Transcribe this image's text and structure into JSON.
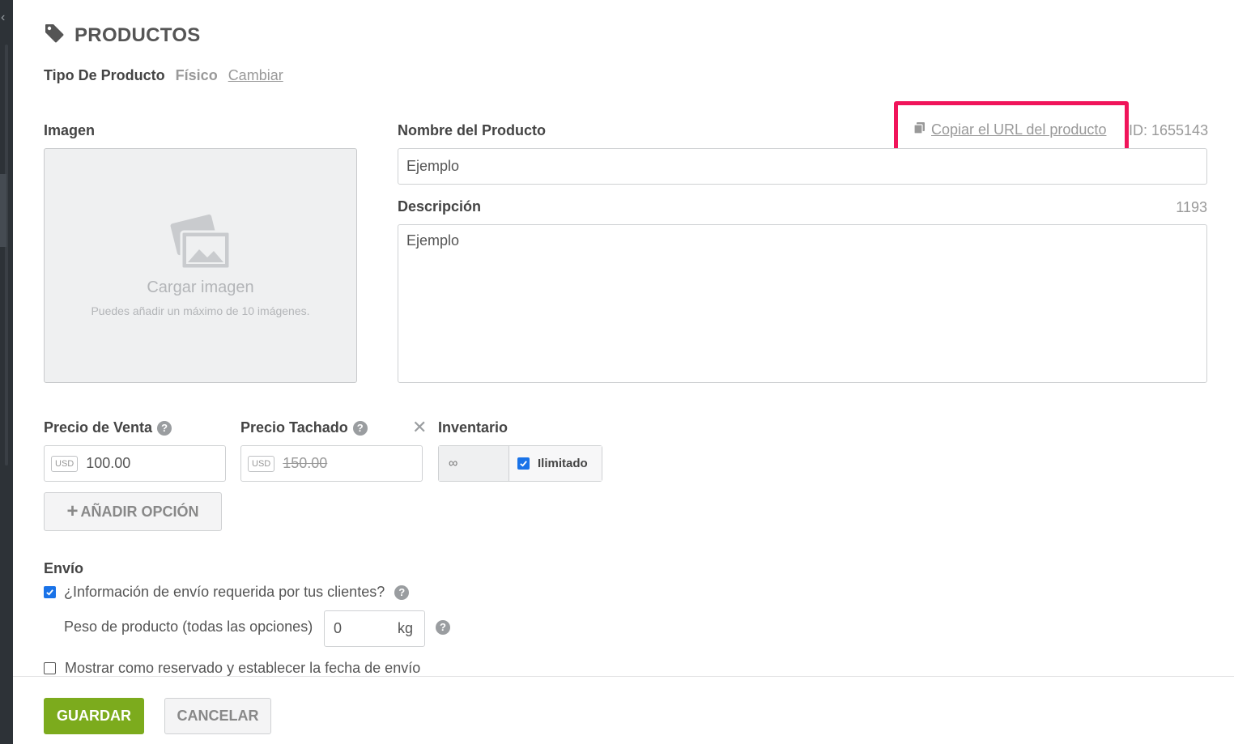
{
  "header": {
    "title": "PRODUCTOS",
    "icon": "tag-icon"
  },
  "product_type": {
    "label": "Tipo De Producto",
    "value": "Físico",
    "change_link": "Cambiar"
  },
  "image": {
    "label": "Imagen",
    "upload_title": "Cargar imagen",
    "upload_hint": "Puedes añadir un máximo de 10 imágenes."
  },
  "name": {
    "label": "Nombre del Producto",
    "copy_url": "Copiar el URL del producto",
    "id_text": "ID: 1655143",
    "value": "Ejemplo"
  },
  "description": {
    "label": "Descripción",
    "count": "1193",
    "value": "Ejemplo"
  },
  "pricing": {
    "sale_label": "Precio de Venta",
    "sale_currency": "USD",
    "sale_value": "100.00",
    "strike_label": "Precio Tachado",
    "strike_currency": "USD",
    "strike_value": "150.00",
    "clear_symbol": "✕"
  },
  "inventory": {
    "label": "Inventario",
    "value": "∞",
    "unlimited_label": "Ilimitado",
    "unlimited_checked": true
  },
  "add_option": {
    "plus": "+",
    "label": "AÑADIR OPCIÓN"
  },
  "shipping": {
    "label": "Envío",
    "required_label": "¿Información de envío requerida por tus clientes?",
    "required_checked": true,
    "weight_label": "Peso de producto (todas las opciones)",
    "weight_value": "0",
    "weight_unit": "kg",
    "preorder_label": "Mostrar como reservado y establecer la fecha de envío",
    "preorder_checked": false
  },
  "footer": {
    "save": "GUARDAR",
    "cancel": "CANCELAR"
  },
  "colors": {
    "accent_green": "#7cab1d",
    "highlight": "#f0145a",
    "checkbox_blue": "#1a73e8"
  }
}
